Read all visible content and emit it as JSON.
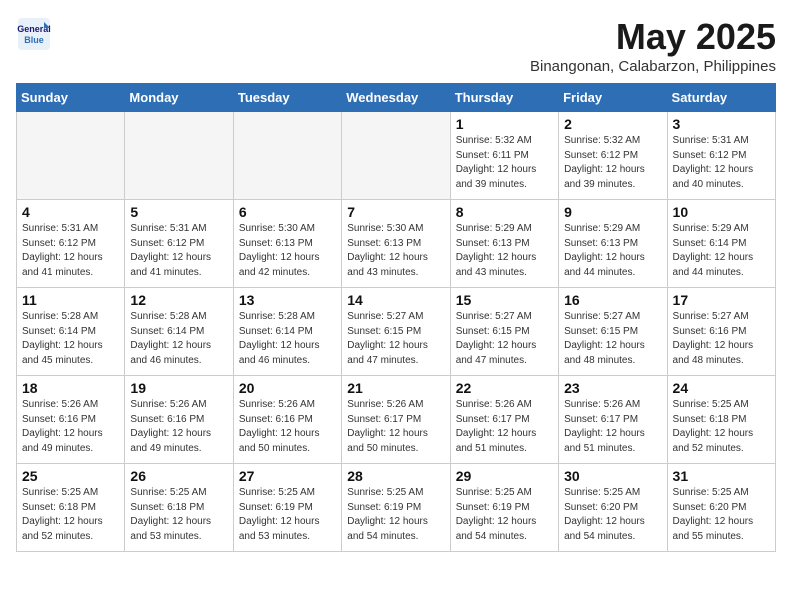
{
  "header": {
    "logo_line1": "General",
    "logo_line2": "Blue",
    "month": "May 2025",
    "location": "Binangonan, Calabarzon, Philippines"
  },
  "weekdays": [
    "Sunday",
    "Monday",
    "Tuesday",
    "Wednesday",
    "Thursday",
    "Friday",
    "Saturday"
  ],
  "weeks": [
    [
      {
        "day": "",
        "info": ""
      },
      {
        "day": "",
        "info": ""
      },
      {
        "day": "",
        "info": ""
      },
      {
        "day": "",
        "info": ""
      },
      {
        "day": "1",
        "info": "Sunrise: 5:32 AM\nSunset: 6:11 PM\nDaylight: 12 hours\nand 39 minutes."
      },
      {
        "day": "2",
        "info": "Sunrise: 5:32 AM\nSunset: 6:12 PM\nDaylight: 12 hours\nand 39 minutes."
      },
      {
        "day": "3",
        "info": "Sunrise: 5:31 AM\nSunset: 6:12 PM\nDaylight: 12 hours\nand 40 minutes."
      }
    ],
    [
      {
        "day": "4",
        "info": "Sunrise: 5:31 AM\nSunset: 6:12 PM\nDaylight: 12 hours\nand 41 minutes."
      },
      {
        "day": "5",
        "info": "Sunrise: 5:31 AM\nSunset: 6:12 PM\nDaylight: 12 hours\nand 41 minutes."
      },
      {
        "day": "6",
        "info": "Sunrise: 5:30 AM\nSunset: 6:13 PM\nDaylight: 12 hours\nand 42 minutes."
      },
      {
        "day": "7",
        "info": "Sunrise: 5:30 AM\nSunset: 6:13 PM\nDaylight: 12 hours\nand 43 minutes."
      },
      {
        "day": "8",
        "info": "Sunrise: 5:29 AM\nSunset: 6:13 PM\nDaylight: 12 hours\nand 43 minutes."
      },
      {
        "day": "9",
        "info": "Sunrise: 5:29 AM\nSunset: 6:13 PM\nDaylight: 12 hours\nand 44 minutes."
      },
      {
        "day": "10",
        "info": "Sunrise: 5:29 AM\nSunset: 6:14 PM\nDaylight: 12 hours\nand 44 minutes."
      }
    ],
    [
      {
        "day": "11",
        "info": "Sunrise: 5:28 AM\nSunset: 6:14 PM\nDaylight: 12 hours\nand 45 minutes."
      },
      {
        "day": "12",
        "info": "Sunrise: 5:28 AM\nSunset: 6:14 PM\nDaylight: 12 hours\nand 46 minutes."
      },
      {
        "day": "13",
        "info": "Sunrise: 5:28 AM\nSunset: 6:14 PM\nDaylight: 12 hours\nand 46 minutes."
      },
      {
        "day": "14",
        "info": "Sunrise: 5:27 AM\nSunset: 6:15 PM\nDaylight: 12 hours\nand 47 minutes."
      },
      {
        "day": "15",
        "info": "Sunrise: 5:27 AM\nSunset: 6:15 PM\nDaylight: 12 hours\nand 47 minutes."
      },
      {
        "day": "16",
        "info": "Sunrise: 5:27 AM\nSunset: 6:15 PM\nDaylight: 12 hours\nand 48 minutes."
      },
      {
        "day": "17",
        "info": "Sunrise: 5:27 AM\nSunset: 6:16 PM\nDaylight: 12 hours\nand 48 minutes."
      }
    ],
    [
      {
        "day": "18",
        "info": "Sunrise: 5:26 AM\nSunset: 6:16 PM\nDaylight: 12 hours\nand 49 minutes."
      },
      {
        "day": "19",
        "info": "Sunrise: 5:26 AM\nSunset: 6:16 PM\nDaylight: 12 hours\nand 49 minutes."
      },
      {
        "day": "20",
        "info": "Sunrise: 5:26 AM\nSunset: 6:16 PM\nDaylight: 12 hours\nand 50 minutes."
      },
      {
        "day": "21",
        "info": "Sunrise: 5:26 AM\nSunset: 6:17 PM\nDaylight: 12 hours\nand 50 minutes."
      },
      {
        "day": "22",
        "info": "Sunrise: 5:26 AM\nSunset: 6:17 PM\nDaylight: 12 hours\nand 51 minutes."
      },
      {
        "day": "23",
        "info": "Sunrise: 5:26 AM\nSunset: 6:17 PM\nDaylight: 12 hours\nand 51 minutes."
      },
      {
        "day": "24",
        "info": "Sunrise: 5:25 AM\nSunset: 6:18 PM\nDaylight: 12 hours\nand 52 minutes."
      }
    ],
    [
      {
        "day": "25",
        "info": "Sunrise: 5:25 AM\nSunset: 6:18 PM\nDaylight: 12 hours\nand 52 minutes."
      },
      {
        "day": "26",
        "info": "Sunrise: 5:25 AM\nSunset: 6:18 PM\nDaylight: 12 hours\nand 53 minutes."
      },
      {
        "day": "27",
        "info": "Sunrise: 5:25 AM\nSunset: 6:19 PM\nDaylight: 12 hours\nand 53 minutes."
      },
      {
        "day": "28",
        "info": "Sunrise: 5:25 AM\nSunset: 6:19 PM\nDaylight: 12 hours\nand 54 minutes."
      },
      {
        "day": "29",
        "info": "Sunrise: 5:25 AM\nSunset: 6:19 PM\nDaylight: 12 hours\nand 54 minutes."
      },
      {
        "day": "30",
        "info": "Sunrise: 5:25 AM\nSunset: 6:20 PM\nDaylight: 12 hours\nand 54 minutes."
      },
      {
        "day": "31",
        "info": "Sunrise: 5:25 AM\nSunset: 6:20 PM\nDaylight: 12 hours\nand 55 minutes."
      }
    ]
  ]
}
